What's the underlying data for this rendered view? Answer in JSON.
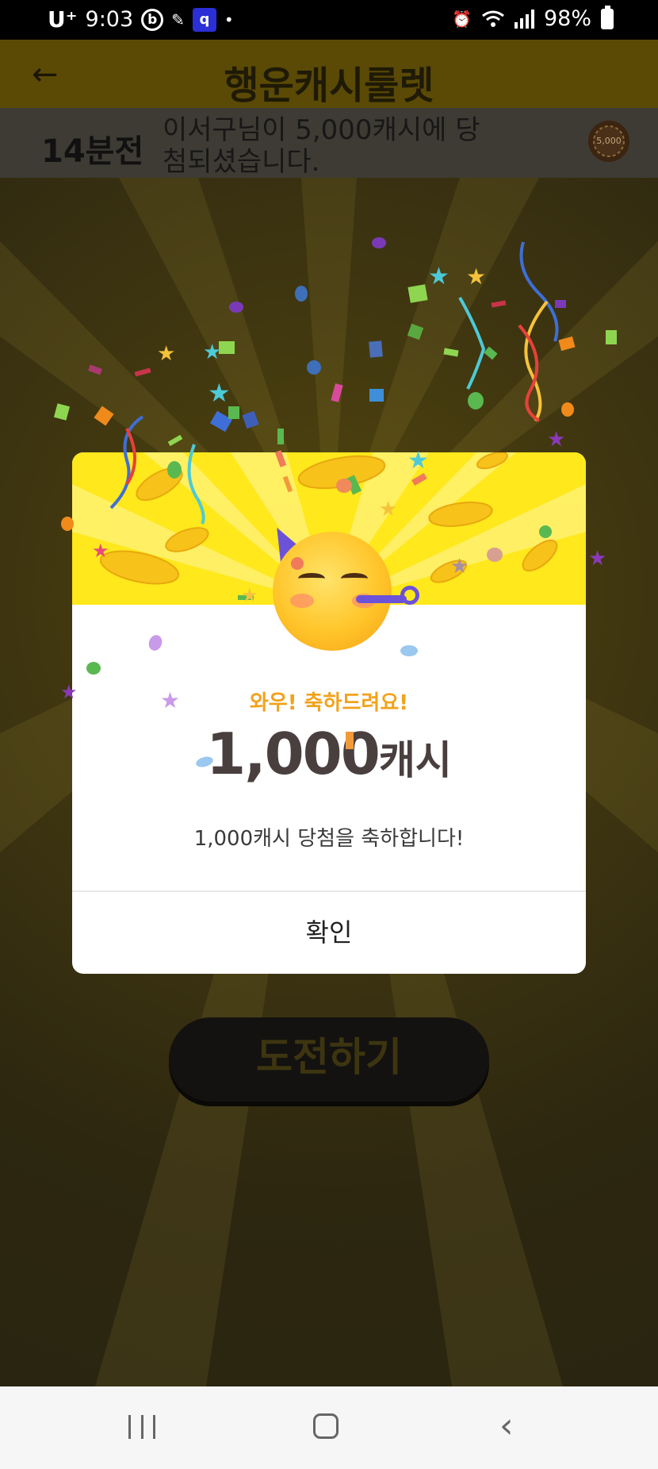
{
  "status_bar": {
    "carrier": "U⁺",
    "time": "9:03",
    "notif_icons": [
      "b-icon",
      "app-icon",
      "q-icon",
      "dot-icon"
    ],
    "battery": "98%",
    "right_icons": [
      "alarm-icon",
      "wifi-icon",
      "signal-icon",
      "battery-icon"
    ]
  },
  "header": {
    "title": "행운캐시룰렛"
  },
  "ticker": {
    "time_ago": "14분전",
    "message": "이서구님이 5,000캐시에 당첨되셨습니다.",
    "badge": "5,000"
  },
  "dialog": {
    "subtitle": "와우! 축하드려요!",
    "amount": "1,000",
    "unit": "캐시",
    "message": "1,000캐시 당첨을 축하합니다!",
    "confirm_label": "확인"
  },
  "challenge_button": {
    "label": "도전하기"
  },
  "colors": {
    "header_bg": "#5a4a05",
    "dialog_top": "#ffe81c",
    "subtitle": "#f2a21c",
    "amount": "#4a3f3f"
  }
}
